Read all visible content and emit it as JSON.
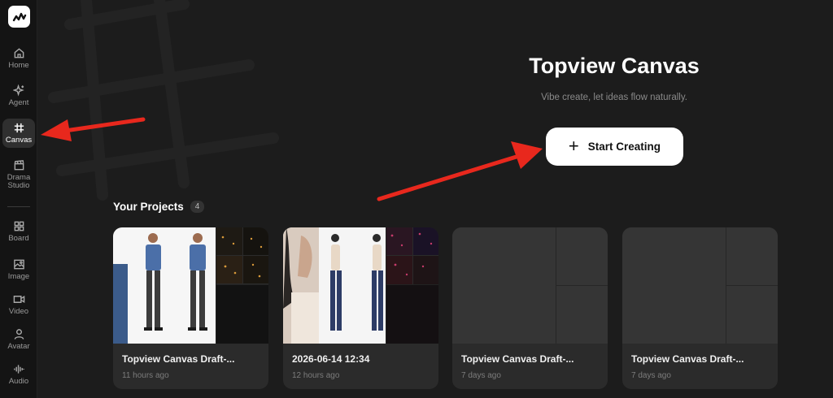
{
  "sidebar": {
    "items": [
      {
        "label": "Home",
        "icon": "home-icon"
      },
      {
        "label": "Agent",
        "icon": "sparkle-icon"
      },
      {
        "label": "Canvas",
        "icon": "hashtag-icon"
      },
      {
        "label": "Drama\nStudio",
        "icon": "clapperboard-icon"
      },
      {
        "label": "Board",
        "icon": "board-icon"
      },
      {
        "label": "Image",
        "icon": "image-icon"
      },
      {
        "label": "Video",
        "icon": "video-icon"
      },
      {
        "label": "Avatar",
        "icon": "person-icon"
      },
      {
        "label": "Audio",
        "icon": "waveform-icon"
      }
    ],
    "active": "Canvas"
  },
  "hero": {
    "title": "Topview Canvas",
    "subtitle": "Vibe create, let ideas flow naturally.",
    "button_label": "Start Creating"
  },
  "projects": {
    "title": "Your Projects",
    "count": "4",
    "cards": [
      {
        "title": "Topview Canvas Draft-...",
        "time": "11 hours ago"
      },
      {
        "title": "2026-06-14 12:34",
        "time": "12 hours ago"
      },
      {
        "title": "Topview Canvas Draft-...",
        "time": "7 days ago"
      },
      {
        "title": "Topview Canvas Draft-...",
        "time": "7 days ago"
      }
    ]
  },
  "colors": {
    "background": "#1c1c1c",
    "sidebar": "#141414",
    "card": "#2b2b2b",
    "annotation_arrow": "#e8281d"
  }
}
